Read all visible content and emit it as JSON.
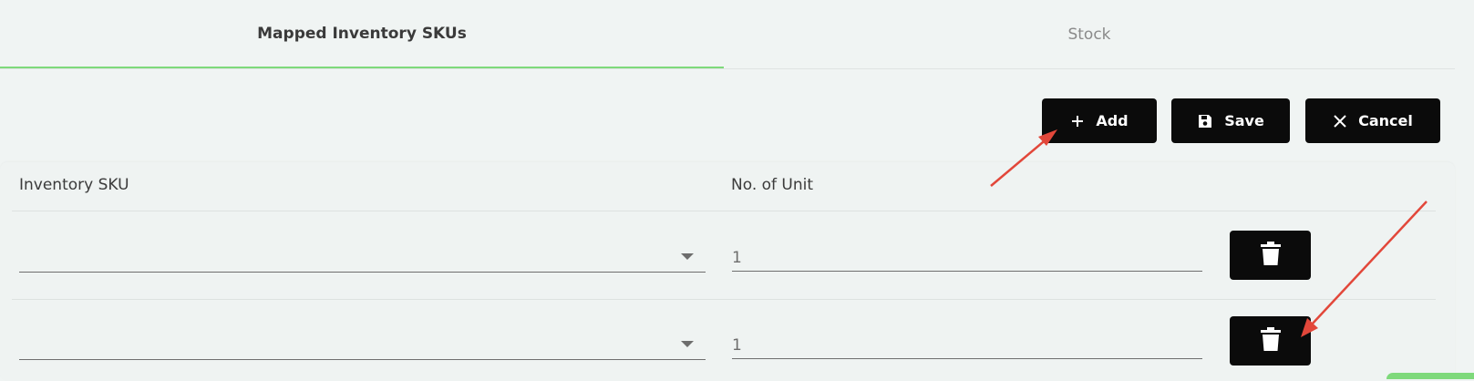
{
  "tabs": [
    {
      "label": "Mapped Inventory SKUs",
      "active": true
    },
    {
      "label": "Stock",
      "active": false
    }
  ],
  "toolbar": {
    "add_label": "Add",
    "save_label": "Save",
    "cancel_label": "Cancel"
  },
  "table": {
    "columns": [
      "Inventory SKU",
      "No. of Unit"
    ],
    "rows": [
      {
        "sku": "",
        "units": "1"
      },
      {
        "sku": "",
        "units": "1"
      }
    ]
  },
  "colors": {
    "accent": "#7ed97b",
    "button_bg": "#0b0b0b",
    "annotation_arrow": "#e2473a",
    "background": "#f0f4f3"
  },
  "icons": [
    "plus-icon",
    "save-icon",
    "close-icon",
    "chevron-down-icon",
    "trash-icon"
  ]
}
